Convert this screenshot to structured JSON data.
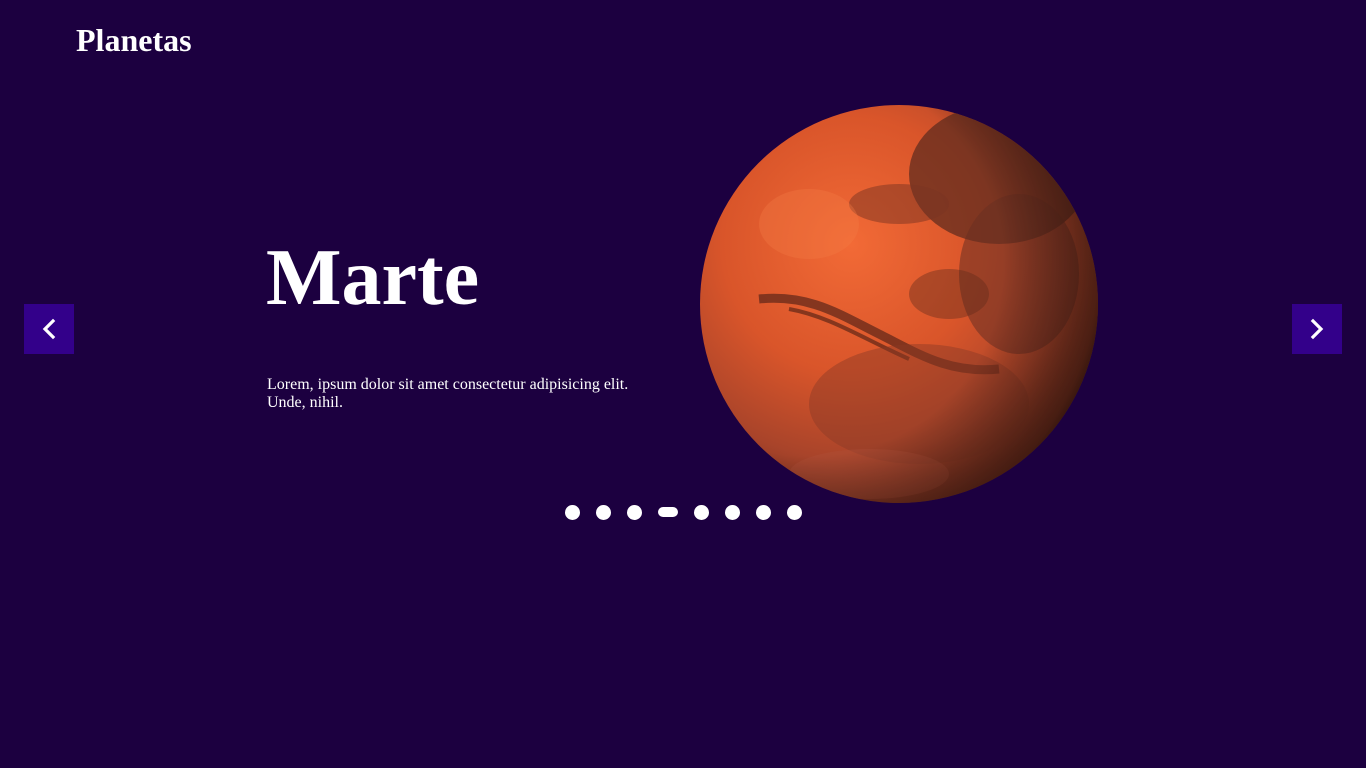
{
  "header": {
    "title": "Planetas"
  },
  "slide": {
    "heading": "Marte",
    "text": "Lorem, ipsum dolor sit amet consectetur adipisicing elit. Unde, nihil."
  },
  "navigation": {
    "prev_icon": "chevron-left-icon",
    "next_icon": "chevron-right-icon",
    "button_color": "#33008a"
  },
  "carousel": {
    "slide_count": 8,
    "active_index": 3
  },
  "colors": {
    "background": "#1c0040",
    "text": "#ffffff",
    "planet": "#c1502a"
  }
}
